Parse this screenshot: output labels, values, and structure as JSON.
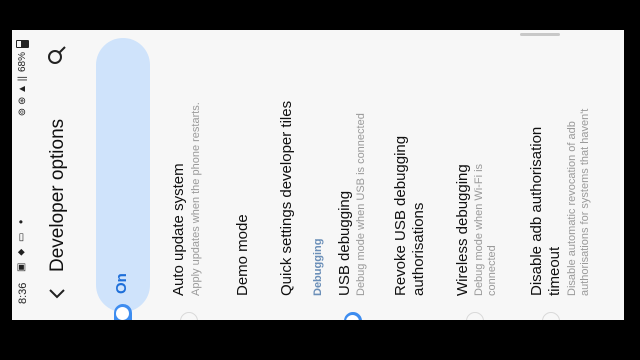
{
  "status_bar": {
    "time": "8:36",
    "left_icons": "▣ ⬥ ▭",
    "dot": "•",
    "right_icons": "⊚ ⊛ ▲ ||",
    "battery": "68%"
  },
  "header": {
    "title": "Developer options",
    "back_icon": "chevron-left",
    "search_icon": "search"
  },
  "master_switch": {
    "label": "On",
    "state": "on"
  },
  "items": [
    {
      "title": "Auto update system",
      "subtitle": "Apply updates when the phone restarts.",
      "toggle": "off"
    },
    {
      "title": "Demo mode",
      "subtitle": ""
    },
    {
      "title": "Quick settings developer tiles",
      "subtitle": ""
    }
  ],
  "section_debugging": "Debugging",
  "debug_items": [
    {
      "title": "USB debugging",
      "subtitle": "Debug mode when USB is connected",
      "toggle": "on"
    },
    {
      "title": "Revoke USB debugging authorisations",
      "subtitle": ""
    },
    {
      "title": "Wireless debugging",
      "subtitle": "Debug mode when Wi-Fi is connected",
      "toggle": "off"
    },
    {
      "title": "Disable adb authorisation timeout",
      "subtitle": "Disable automatic revocation of adb authorisations for systems that haven't",
      "toggle": "off"
    }
  ],
  "colors": {
    "accent": "#3e8df0",
    "master_bg": "#cfe3fb",
    "background": "#f7f7f7"
  }
}
